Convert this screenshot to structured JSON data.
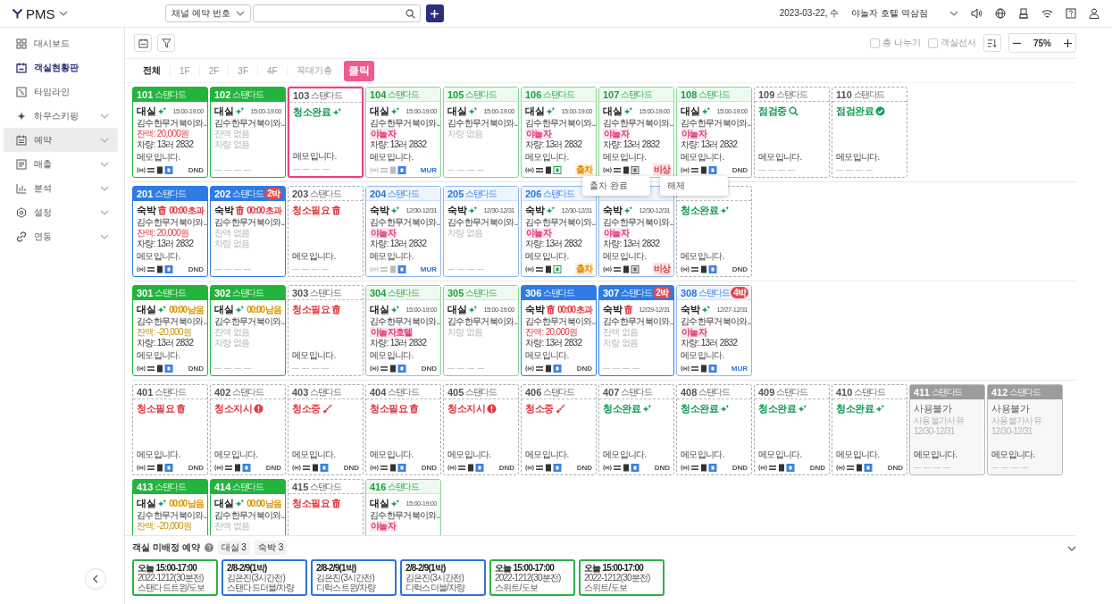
{
  "topbar": {
    "brand": "PMS",
    "search_type": "채널 예약 번호",
    "date": "2023-03-22, 수",
    "property": "야놀자 호텔 역삼점"
  },
  "sidebar": {
    "items": [
      {
        "label": "대시보드",
        "selected": false,
        "expandable": false,
        "highlighted": false
      },
      {
        "label": "객실현황판",
        "selected": true,
        "expandable": false,
        "highlighted": false
      },
      {
        "label": "타임라인",
        "selected": false,
        "expandable": false,
        "highlighted": false
      },
      {
        "label": "하우스키핑",
        "selected": false,
        "expandable": true,
        "highlighted": false
      },
      {
        "label": "예약",
        "selected": false,
        "expandable": true,
        "highlighted": true
      },
      {
        "label": "매출",
        "selected": false,
        "expandable": true,
        "highlighted": false
      },
      {
        "label": "분석",
        "selected": false,
        "expandable": true,
        "highlighted": false
      },
      {
        "label": "설정",
        "selected": false,
        "expandable": true,
        "highlighted": false
      },
      {
        "label": "연동",
        "selected": false,
        "expandable": true,
        "highlighted": false
      }
    ]
  },
  "toolbar": {
    "options": [
      {
        "label": "층 나누기",
        "checked": false
      },
      {
        "label": "객실선서",
        "checked": false
      }
    ],
    "zoom": "75%"
  },
  "tabs": [
    {
      "label": "전체",
      "selected": true
    },
    {
      "label": "1F",
      "selected": false
    },
    {
      "label": "2F",
      "selected": false
    },
    {
      "label": "3F",
      "selected": false
    },
    {
      "label": "4F",
      "selected": false
    },
    {
      "label": "꼭대기층",
      "selected": false
    }
  ],
  "tooltip": "클릭",
  "popups": [
    "출차 완료",
    "해제"
  ],
  "floors": [
    {
      "cards": [
        {
          "number": "101",
          "type": "스탠다드",
          "kind": "green",
          "selected": false,
          "status": {
            "text": "대실",
            "kind": "sparkle"
          },
          "time": {
            "text": "15:00-19:00",
            "kind": "range"
          },
          "lines": [
            {
              "text": "김수한무거북이와..",
              "kind": "plain"
            },
            {
              "text": "잔액: 20,000원",
              "kind": "due"
            },
            {
              "text": "차량: 13러 2832",
              "kind": "plain"
            }
          ],
          "memo": "메모입니다.",
          "footer": {
            "kind": "blue",
            "tag": {
              "text": "DND",
              "kind": "dnd"
            }
          }
        },
        {
          "number": "102",
          "type": "스탠다드",
          "kind": "green",
          "selected": false,
          "status": {
            "text": "대실",
            "kind": "sparkle"
          },
          "time": {
            "text": "15:00-19:00",
            "kind": "range"
          },
          "lines": [
            {
              "text": "김수한무거북이와..",
              "kind": "plain"
            },
            {
              "text": "잔액 없음",
              "kind": "muted"
            },
            {
              "text": "차량 없음",
              "kind": "muted"
            }
          ],
          "footer": {
            "kind": "empty"
          }
        },
        {
          "number": "103",
          "type": "스탠다드",
          "kind": "dashed",
          "selected": true,
          "status": {
            "text": "청소완료",
            "kind": "sparkle"
          },
          "memo": "메모입니다.",
          "footer": {
            "kind": "empty"
          }
        },
        {
          "number": "104",
          "type": "스탠다드",
          "kind": "green-light",
          "selected": false,
          "status": {
            "text": "대실",
            "kind": "sparkle"
          },
          "time": {
            "text": "15:00-19:00",
            "kind": "range"
          },
          "lines": [
            {
              "text": "김수한무거북이와..",
              "kind": "plain"
            },
            {
              "text": "야놀자",
              "kind": "channel"
            },
            {
              "text": "차량: 13러 2832",
              "kind": "plain"
            }
          ],
          "memo": "메모입니다.",
          "footer": {
            "kind": "dim",
            "tag": {
              "text": "MUR",
              "kind": "mur"
            }
          }
        },
        {
          "number": "105",
          "type": "스탠다드",
          "kind": "green-light",
          "selected": false,
          "status": {
            "text": "대실",
            "kind": "sparkle"
          },
          "time": {
            "text": "15:00-19:00",
            "kind": "range"
          },
          "lines": [
            {
              "text": "김수한무거북이와..",
              "kind": "plain"
            },
            {
              "text": "차량 없음",
              "kind": "muted"
            }
          ],
          "footer": {
            "kind": "empty"
          }
        },
        {
          "number": "106",
          "type": "스탠다드",
          "kind": "green-light",
          "selected": false,
          "status": {
            "text": "대실",
            "kind": "sparkle"
          },
          "time": {
            "text": "15:00-19:00",
            "kind": "range"
          },
          "lines": [
            {
              "text": "김수한무거북이와..",
              "kind": "plain"
            },
            {
              "text": "야놀자",
              "kind": "channel"
            },
            {
              "text": "차량: 13러 2832",
              "kind": "plain"
            }
          ],
          "memo": "메모입니다.",
          "footer": {
            "kind": "green",
            "tag": {
              "text": "출차",
              "kind": "out"
            }
          }
        },
        {
          "number": "107",
          "type": "스탠다드",
          "kind": "green-light",
          "selected": false,
          "status": {
            "text": "대실",
            "kind": "sparkle"
          },
          "time": {
            "text": "15:00-19:00",
            "kind": "range"
          },
          "lines": [
            {
              "text": "김수한무거북이와..",
              "kind": "plain"
            },
            {
              "text": "야놀자",
              "kind": "channel"
            },
            {
              "text": "차량: 13러 2832",
              "kind": "plain"
            }
          ],
          "memo": "메모입니다.",
          "footer": {
            "kind": "gray",
            "tag": {
              "text": "비상",
              "kind": "alarm"
            }
          }
        },
        {
          "number": "108",
          "type": "스탠다드",
          "kind": "green-light",
          "selected": false,
          "status": {
            "text": "대실",
            "kind": "sparkle"
          },
          "time": {
            "text": "15:00-19:00",
            "kind": "range"
          },
          "lines": [
            {
              "text": "김수한무거북이와..",
              "kind": "plain"
            },
            {
              "text": "야놀자",
              "kind": "channel"
            },
            {
              "text": "차량: 13러 2832",
              "kind": "plain"
            }
          ],
          "memo": "메모입니다.",
          "footer": {
            "kind": "blue",
            "tag": {
              "text": "DND",
              "kind": "dnd"
            }
          }
        },
        {
          "number": "109",
          "type": "스탠다드",
          "kind": "dashed",
          "selected": false,
          "status": {
            "text": "점검중",
            "kind": "search"
          },
          "memo": "메모입니다.",
          "footer": {
            "kind": "empty"
          }
        },
        {
          "number": "110",
          "type": "스탠다드",
          "kind": "dashed",
          "selected": false,
          "status": {
            "text": "점검완료",
            "kind": "check"
          },
          "memo": "메모입니다.",
          "footer": {
            "kind": "empty"
          }
        }
      ]
    },
    {
      "cards": [
        {
          "number": "201",
          "type": "스탠다드",
          "kind": "blue",
          "selected": false,
          "status": {
            "text": "숙박",
            "kind": "trash"
          },
          "time": {
            "text": "00:00 초과",
            "kind": "overdue"
          },
          "lines": [
            {
              "text": "김수한무거북이와..",
              "kind": "plain"
            },
            {
              "text": "잔액: 20,000원",
              "kind": "due"
            },
            {
              "text": "차량: 13러 2832",
              "kind": "plain"
            }
          ],
          "memo": "메모입니다.",
          "footer": {
            "kind": "blue",
            "tag": {
              "text": "DND",
              "kind": "dnd"
            }
          }
        },
        {
          "number": "202",
          "type": "스탠다드",
          "kind": "blue",
          "selected": false,
          "badge": "2박",
          "status": {
            "text": "숙박",
            "kind": "trash"
          },
          "time": {
            "text": "00:00 초과",
            "kind": "overdue"
          },
          "lines": [
            {
              "text": "김수한무거북이와..",
              "kind": "plain"
            },
            {
              "text": "잔액 없음",
              "kind": "muted"
            },
            {
              "text": "차량 없음",
              "kind": "muted"
            }
          ],
          "footer": {
            "kind": "empty"
          }
        },
        {
          "number": "203",
          "type": "스탠다드",
          "kind": "dashed",
          "selected": false,
          "status": {
            "text": "청소필요",
            "kind": "trash"
          },
          "memo": "메모입니다.",
          "footer": {
            "kind": "empty"
          }
        },
        {
          "number": "204",
          "type": "스탠다드",
          "kind": "blue-light",
          "selected": false,
          "status": {
            "text": "숙박",
            "kind": "sparkle"
          },
          "time": {
            "text": "12/30-12/31",
            "kind": "range"
          },
          "lines": [
            {
              "text": "김수한무거북이와..",
              "kind": "plain"
            },
            {
              "text": "야놀자",
              "kind": "channel"
            },
            {
              "text": "차량: 13러 2832",
              "kind": "plain"
            }
          ],
          "memo": "메모입니다.",
          "footer": {
            "kind": "dim",
            "tag": {
              "text": "MUR",
              "kind": "mur"
            }
          }
        },
        {
          "number": "205",
          "type": "스탠다드",
          "kind": "blue-light",
          "selected": false,
          "status": {
            "text": "숙박",
            "kind": "sparkle"
          },
          "time": {
            "text": "12/30-12/31",
            "kind": "range"
          },
          "lines": [
            {
              "text": "김수한무거북이와..",
              "kind": "plain"
            },
            {
              "text": "차량 없음",
              "kind": "muted"
            }
          ],
          "footer": {
            "kind": "empty"
          }
        },
        {
          "number": "206",
          "type": "스탠다드",
          "kind": "blue-light",
          "selected": false,
          "status": {
            "text": "숙박",
            "kind": "sparkle"
          },
          "time": {
            "text": "12/30-12/31",
            "kind": "range"
          },
          "lines": [
            {
              "text": "김수한무거북이와..",
              "kind": "plain"
            },
            {
              "text": "야놀자",
              "kind": "channel"
            },
            {
              "text": "차량: 13러 2832",
              "kind": "plain"
            }
          ],
          "memo": "메모입니다.",
          "footer": {
            "kind": "green",
            "tag": {
              "text": "출차",
              "kind": "out"
            }
          }
        },
        {
          "kind": "blue-light",
          "selected": false,
          "status": {
            "text": "숙박",
            "kind": "sparkle"
          },
          "time": {
            "text": "12/30-12/31",
            "kind": "range"
          },
          "lines": [
            {
              "text": "김수한무거북이와..",
              "kind": "plain"
            },
            {
              "text": "야놀자",
              "kind": "channel"
            },
            {
              "text": "차량: 13러 2832",
              "kind": "plain"
            }
          ],
          "memo": "메모입니다.",
          "footer": {
            "kind": "gray",
            "tag": {
              "text": "비상",
              "kind": "alarm"
            }
          }
        },
        {
          "kind": "dashed",
          "selected": false,
          "status": {
            "text": "청소완료",
            "kind": "sparkle"
          },
          "memo": "메모입니다.",
          "footer": {
            "kind": "blue",
            "tag": {
              "text": "DND",
              "kind": "dnd"
            }
          }
        }
      ]
    },
    {
      "cards": [
        {
          "number": "301",
          "type": "스탠다드",
          "kind": "green",
          "selected": false,
          "status": {
            "text": "대실",
            "kind": "sparkle"
          },
          "time": {
            "text": "00:00 남음",
            "kind": "remaining"
          },
          "lines": [
            {
              "text": "김수한무거북이와..",
              "kind": "plain"
            },
            {
              "text": "잔액: -20,000원",
              "kind": "credit"
            },
            {
              "text": "차량: 13러 2832",
              "kind": "plain"
            }
          ],
          "memo": "메모입니다.",
          "footer": {
            "kind": "blue",
            "tag": {
              "text": "DND",
              "kind": "dnd"
            }
          }
        },
        {
          "number": "302",
          "type": "스탠다드",
          "kind": "green",
          "selected": false,
          "status": {
            "text": "대실",
            "kind": "sparkle"
          },
          "time": {
            "text": "00:00 남음",
            "kind": "remaining"
          },
          "lines": [
            {
              "text": "김수한무거북이와..",
              "kind": "plain"
            },
            {
              "text": "잔액 없음",
              "kind": "muted"
            },
            {
              "text": "차량 없음",
              "kind": "muted"
            }
          ],
          "footer": {
            "kind": "empty"
          }
        },
        {
          "number": "303",
          "type": "스탠다드",
          "kind": "dashed",
          "selected": false,
          "status": {
            "text": "청소필요",
            "kind": "trash"
          },
          "memo": "메모입니다.",
          "footer": {
            "kind": "empty"
          }
        },
        {
          "number": "304",
          "type": "스탠다드",
          "kind": "green-light",
          "selected": false,
          "status": {
            "text": "대실",
            "kind": "sparkle"
          },
          "time": {
            "text": "15:00-19:00",
            "kind": "range"
          },
          "lines": [
            {
              "text": "김수한무거북이와..",
              "kind": "plain"
            },
            {
              "text": "야놀자호텔",
              "kind": "channel"
            },
            {
              "text": "차량: 13러 2832",
              "kind": "plain"
            }
          ],
          "memo": "메모입니다.",
          "footer": {
            "kind": "blue",
            "tag": {
              "text": "DND",
              "kind": "dnd"
            }
          }
        },
        {
          "number": "305",
          "type": "스탠다드",
          "kind": "green-light",
          "selected": false,
          "status": {
            "text": "대실",
            "kind": "sparkle"
          },
          "time": {
            "text": "15:00-19:00",
            "kind": "range"
          },
          "lines": [
            {
              "text": "김수한무거북이와..",
              "kind": "plain"
            },
            {
              "text": "차량 없음",
              "kind": "muted"
            }
          ],
          "footer": {
            "kind": "empty"
          }
        },
        {
          "number": "306",
          "type": "스탠다드",
          "kind": "blue",
          "selected": false,
          "status": {
            "text": "숙박",
            "kind": "trash"
          },
          "time": {
            "text": "00:00 초과",
            "kind": "overdue"
          },
          "lines": [
            {
              "text": "김수한무거북이와..",
              "kind": "plain"
            },
            {
              "text": "잔액: 20,000원",
              "kind": "due"
            },
            {
              "text": "차량: 13러 2832",
              "kind": "plain"
            }
          ],
          "memo": "메모입니다.",
          "footer": {
            "kind": "blue",
            "tag": {
              "text": "DND",
              "kind": "dnd"
            }
          }
        },
        {
          "number": "307",
          "type": "스탠다드",
          "kind": "blue",
          "selected": false,
          "badge": "2박",
          "status": {
            "text": "숙박",
            "kind": "trash"
          },
          "time": {
            "text": "12/29-12/31",
            "kind": "range"
          },
          "lines": [
            {
              "text": "김수한무거북이와..",
              "kind": "plain"
            },
            {
              "text": "잔액 없음",
              "kind": "muted"
            },
            {
              "text": "차량 없음",
              "kind": "muted"
            }
          ],
          "footer": {
            "kind": "empty"
          }
        },
        {
          "number": "308",
          "type": "스탠다드",
          "kind": "blue-light",
          "selected": false,
          "badge": "4박",
          "status": {
            "text": "숙박",
            "kind": "sparkle"
          },
          "time": {
            "text": "12/27-12/31",
            "kind": "range"
          },
          "lines": [
            {
              "text": "김수한무거북이와..",
              "kind": "plain"
            },
            {
              "text": "야놀자",
              "kind": "channel"
            },
            {
              "text": "차량: 13러 2832",
              "kind": "plain"
            }
          ],
          "memo": "메모입니다.",
          "footer": {
            "kind": "blue",
            "tag": {
              "text": "MUR",
              "kind": "mur"
            }
          }
        }
      ]
    },
    {
      "cards": [
        {
          "number": "401",
          "type": "스탠다드",
          "kind": "dashed",
          "selected": false,
          "status": {
            "text": "청소필요",
            "kind": "trash"
          },
          "memo": "메모입니다.",
          "footer": {
            "kind": "blue",
            "tag": {
              "text": "DND",
              "kind": "dnd"
            }
          }
        },
        {
          "number": "402",
          "type": "스탠다드",
          "kind": "dashed",
          "selected": false,
          "status": {
            "text": "청소지시",
            "kind": "alert"
          },
          "memo": "메모입니다.",
          "footer": {
            "kind": "blue",
            "tag": {
              "text": "DND",
              "kind": "dnd"
            }
          }
        },
        {
          "number": "403",
          "type": "스탠다드",
          "kind": "dashed",
          "selected": false,
          "status": {
            "text": "청소중",
            "kind": "broom"
          },
          "memo": "메모입니다.",
          "footer": {
            "kind": "blue",
            "tag": {
              "text": "DND",
              "kind": "dnd"
            }
          }
        },
        {
          "number": "404",
          "type": "스탠다드",
          "kind": "dashed",
          "selected": false,
          "status": {
            "text": "청소필요",
            "kind": "trash"
          },
          "memo": "메모입니다.",
          "footer": {
            "kind": "blue",
            "tag": {
              "text": "DND",
              "kind": "dnd"
            }
          }
        },
        {
          "number": "405",
          "type": "스탠다드",
          "kind": "dashed",
          "selected": false,
          "status": {
            "text": "청소지시",
            "kind": "alert"
          },
          "memo": "메모입니다.",
          "footer": {
            "kind": "blue",
            "tag": {
              "text": "DND",
              "kind": "dnd"
            }
          }
        },
        {
          "number": "406",
          "type": "스탠다드",
          "kind": "dashed",
          "selected": false,
          "status": {
            "text": "청소중",
            "kind": "broom"
          },
          "memo": "메모입니다.",
          "footer": {
            "kind": "blue",
            "tag": {
              "text": "DND",
              "kind": "dnd"
            }
          }
        },
        {
          "number": "407",
          "type": "스탠다드",
          "kind": "dashed",
          "selected": false,
          "status": {
            "text": "청소완료",
            "kind": "sparkle"
          },
          "memo": "메모입니다.",
          "footer": {
            "kind": "blue",
            "tag": {
              "text": "DND",
              "kind": "dnd"
            }
          }
        },
        {
          "number": "408",
          "type": "스탠다드",
          "kind": "dashed",
          "selected": false,
          "status": {
            "text": "청소완료",
            "kind": "sparkle"
          },
          "memo": "메모입니다.",
          "footer": {
            "kind": "blue",
            "tag": {
              "text": "DND",
              "kind": "dnd"
            }
          }
        },
        {
          "number": "409",
          "type": "스탠다드",
          "kind": "dashed",
          "selected": false,
          "status": {
            "text": "청소완료",
            "kind": "sparkle"
          },
          "memo": "메모입니다.",
          "footer": {
            "kind": "blue",
            "tag": {
              "text": "DND",
              "kind": "dnd"
            }
          }
        },
        {
          "number": "410",
          "type": "스탠다드",
          "kind": "dashed",
          "selected": false,
          "status": {
            "text": "청소완료",
            "kind": "sparkle"
          },
          "memo": "메모입니다.",
          "footer": {
            "kind": "blue",
            "tag": {
              "text": "DND",
              "kind": "dnd"
            }
          }
        },
        {
          "number": "411",
          "type": "스탠다드",
          "kind": "gray",
          "selected": false,
          "status": {
            "text": "사용불가",
            "kind": "plain"
          },
          "lines": [
            {
              "text": "사용불가사유",
              "kind": "muted"
            },
            {
              "text": "12/30-12/31",
              "kind": "muted"
            }
          ],
          "memo": "메모입니다.",
          "footer": {
            "kind": "empty"
          }
        },
        {
          "number": "412",
          "type": "스탠다드",
          "kind": "gray",
          "selected": false,
          "status": {
            "text": "사용불가",
            "kind": "plain"
          },
          "lines": [
            {
              "text": "사용불가사유",
              "kind": "muted"
            },
            {
              "text": "12/30-12/31",
              "kind": "muted"
            }
          ],
          "memo": "메모입니다.",
          "footer": {
            "kind": "empty"
          }
        },
        {
          "number": "413",
          "type": "스탠다드",
          "kind": "green",
          "selected": false,
          "status": {
            "text": "대실",
            "kind": "sparkle"
          },
          "time": {
            "text": "00:00 남음",
            "kind": "remaining"
          },
          "lines": [
            {
              "text": "김수한무거북이와..",
              "kind": "plain"
            },
            {
              "text": "잔액: -20,000원",
              "kind": "credit"
            }
          ]
        },
        {
          "number": "414",
          "type": "스탠다드",
          "kind": "green",
          "selected": false,
          "status": {
            "text": "대실",
            "kind": "sparkle"
          },
          "time": {
            "text": "00:00 남음",
            "kind": "remaining"
          },
          "lines": [
            {
              "text": "김수한무거북이와..",
              "kind": "plain"
            },
            {
              "text": "잔액 없음",
              "kind": "muted"
            }
          ]
        },
        {
          "number": "415",
          "type": "스탠다드",
          "kind": "dashed",
          "selected": false,
          "status": {
            "text": "청소필요",
            "kind": "trash"
          }
        },
        {
          "number": "416",
          "type": "스탠다드",
          "kind": "green-light",
          "selected": false,
          "status": {
            "text": "대실",
            "kind": "sparkle"
          },
          "time": {
            "text": "15:00-19:00",
            "kind": "range"
          },
          "lines": [
            {
              "text": "김수한무거북이와..",
              "kind": "plain"
            },
            {
              "text": "야놀자",
              "kind": "channel"
            }
          ]
        }
      ]
    }
  ],
  "unassigned": {
    "title": "객실 미배정 예약",
    "chips": [
      "대실 3",
      "숙박 3"
    ],
    "reservations": [
      {
        "lines": [
          "오늘 15:00-17:00",
          "2022-1212(30분전)",
          "스탠다드트윈/도보"
        ],
        "color": "#2bb04a"
      },
      {
        "lines": [
          "2/8-2/9(1박)",
          "김은진(3시간전)",
          "스탠다드더블/차량"
        ],
        "color": "#2f72de"
      },
      {
        "lines": [
          "2/8-2/9(1박)",
          "김은진(3시간전)",
          "디럭스트윈/차량"
        ],
        "color": "#2f72de"
      },
      {
        "lines": [
          "2/8-2/9(1박)",
          "김은진(3시간전)",
          "디럭스더블/차량"
        ],
        "color": "#2f72de"
      },
      {
        "lines": [
          "오늘 15:00-17:00",
          "2022-1212(30분전)",
          "스위트/도보"
        ],
        "color": "#2bb04a"
      },
      {
        "lines": [
          "오늘 15:00-17:00",
          "2022-1212(30분전)",
          "스위트/도보"
        ],
        "color": "#2bb04a"
      }
    ]
  }
}
